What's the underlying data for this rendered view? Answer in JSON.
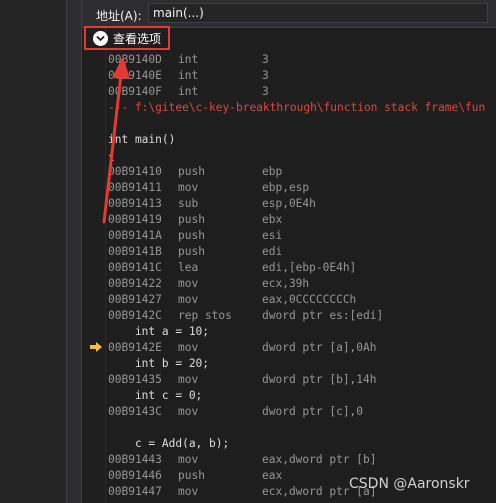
{
  "address_bar": {
    "label": "地址(A):",
    "value": "main(...)"
  },
  "view_options": {
    "label": "查看选项"
  },
  "colors": {
    "highlight": "#e53935",
    "comment": "#e0473b",
    "exec_arrow": "#f0c040"
  },
  "lines": {
    "l1": {
      "addr": "00B9140D",
      "mn": "int",
      "op": "3"
    },
    "l2": {
      "addr": "00B9140E",
      "mn": "int",
      "op": "3"
    },
    "l3": {
      "addr": "00B9140F",
      "mn": "int",
      "op": "3"
    },
    "comment": "--- f:\\gitee\\c-key-breakthrough\\function stack frame\\fun",
    "src_main": "int main()",
    "src_brace": "{",
    "l4": {
      "addr": "00B91410",
      "mn": "push",
      "op": "ebp"
    },
    "l5": {
      "addr": "00B91411",
      "mn": "mov",
      "op": "ebp,esp"
    },
    "l6": {
      "addr": "00B91413",
      "mn": "sub",
      "op": "esp,0E4h"
    },
    "l7": {
      "addr": "00B91419",
      "mn": "push",
      "op": "ebx"
    },
    "l8": {
      "addr": "00B9141A",
      "mn": "push",
      "op": "esi"
    },
    "l9": {
      "addr": "00B9141B",
      "mn": "push",
      "op": "edi"
    },
    "l10": {
      "addr": "00B9141C",
      "mn": "lea",
      "op": "edi,[ebp-0E4h]"
    },
    "l11": {
      "addr": "00B91422",
      "mn": "mov",
      "op": "ecx,39h"
    },
    "l12": {
      "addr": "00B91427",
      "mn": "mov",
      "op": "eax,0CCCCCCCCh"
    },
    "l13": {
      "addr": "00B9142C",
      "mn": "rep stos",
      "op": "dword ptr es:[edi]"
    },
    "src_a": "    int a = 10;",
    "l14": {
      "addr": "00B9142E",
      "mn": "mov",
      "op": "dword ptr [a],0Ah"
    },
    "src_b": "    int b = 20;",
    "l15": {
      "addr": "00B91435",
      "mn": "mov",
      "op": "dword ptr [b],14h"
    },
    "src_c": "    int c = 0;",
    "l16": {
      "addr": "00B9143C",
      "mn": "mov",
      "op": "dword ptr [c],0"
    },
    "src_add": "    c = Add(a, b);",
    "l17": {
      "addr": "00B91443",
      "mn": "mov",
      "op": "eax,dword ptr [b]"
    },
    "l18": {
      "addr": "00B91446",
      "mn": "push",
      "op": "eax"
    },
    "l19": {
      "addr": "00B91447",
      "mn": "mov",
      "op": "ecx,dword ptr [a]"
    }
  },
  "watermark": "CSDN @Aaronskr"
}
